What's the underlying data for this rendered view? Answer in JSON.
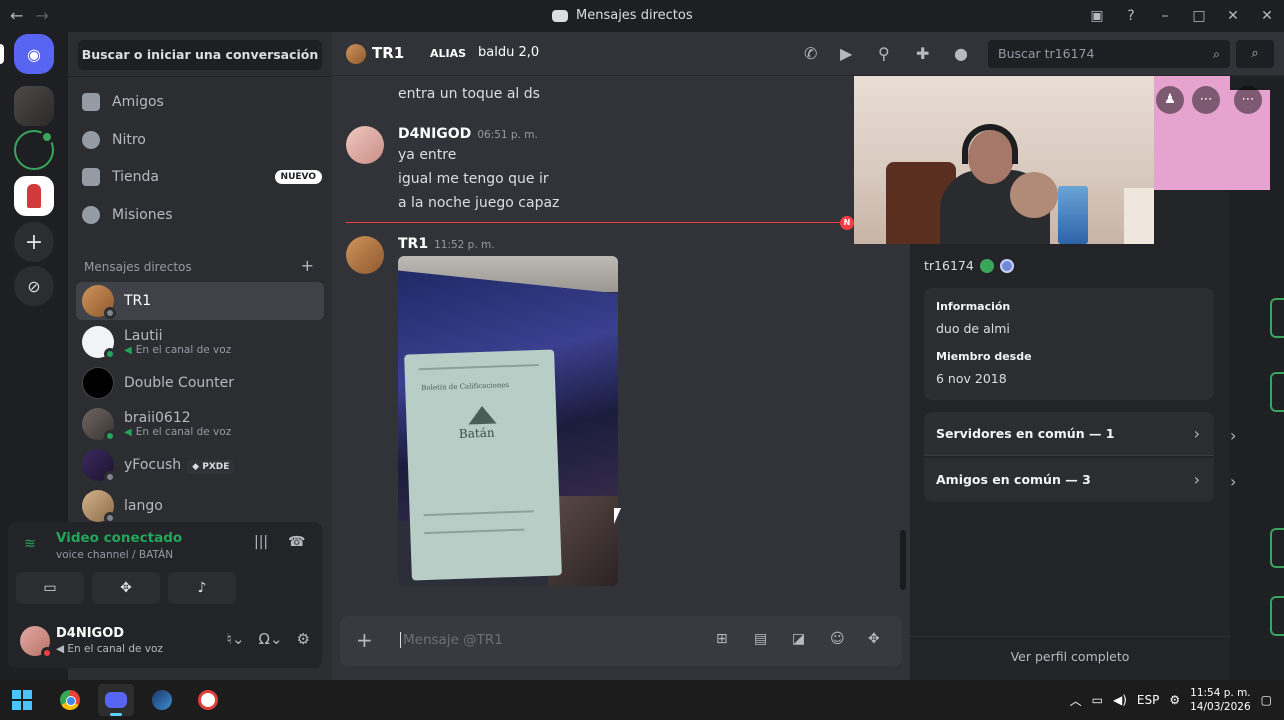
{
  "window": {
    "title": "Mensajes directos"
  },
  "sidebar": {
    "search_label": "Buscar o iniciar una conversación",
    "nav": [
      {
        "label": "Amigos"
      },
      {
        "label": "Nitro"
      },
      {
        "label": "Tienda",
        "badge": "NUEVO"
      },
      {
        "label": "Misiones"
      }
    ],
    "dm_header": "Mensajes directos",
    "dms": [
      {
        "name": "TR1",
        "status": "",
        "active": true
      },
      {
        "name": "Lautii",
        "status": "En el canal de voz"
      },
      {
        "name": "Double Counter",
        "status": ""
      },
      {
        "name": "braii0612",
        "status": "En el canal de voz"
      },
      {
        "name": "yFocush",
        "status": "",
        "tag": "PXDE"
      },
      {
        "name": "lango",
        "status": ""
      }
    ],
    "voice": {
      "state": "Video conectado",
      "channel": "voice channel / BATÁN"
    },
    "user": {
      "name": "D4NIGOD",
      "status": "En el canal de voz"
    }
  },
  "header": {
    "name": "TR1",
    "alias_label": "ALIAS",
    "alias_value": "baldu 2,0",
    "search_placeholder": "Buscar tr16174"
  },
  "chat": {
    "messages": [
      {
        "author": "",
        "time": "",
        "lines": [
          "entra un toque al ds"
        ]
      },
      {
        "author": "D4NIGOD",
        "time": "06:51 p. m.",
        "lines": [
          "ya entre",
          "igual me tengo que ir",
          "a la noche juego capaz"
        ]
      },
      {
        "author": "TR1",
        "time": "11:52 p. m.",
        "attachment": "image"
      }
    ],
    "new_marker": "N",
    "photo_text": {
      "card_title": "Boletín de Calificaciones",
      "school": "Batán"
    },
    "composer_placeholder": "Mensaje @TR1"
  },
  "profile": {
    "handle": "tr16174",
    "info_label": "Información",
    "info_value": "duo de almi",
    "member_since_label": "Miembro desde",
    "member_since_value": "6 nov 2018",
    "servers_common": "Servidores en común — 1",
    "friends_common": "Amigos en común — 3",
    "full_profile": "Ver perfil completo"
  },
  "taskbar": {
    "lang": "ESP",
    "time": "11:54 p. m.",
    "date": "14/03/2026"
  },
  "colors": {
    "blurple": "#5865f2",
    "online": "#23a55a",
    "banner": "#e6a3d0",
    "new_line": "#f23f43"
  }
}
